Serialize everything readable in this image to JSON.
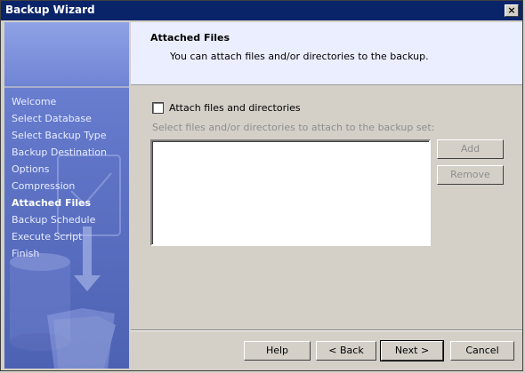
{
  "window": {
    "title": "Backup Wizard",
    "close_label": "×"
  },
  "sidebar": {
    "steps": [
      {
        "label": "Welcome",
        "active": false
      },
      {
        "label": "Select Database",
        "active": false
      },
      {
        "label": "Select Backup Type",
        "active": false
      },
      {
        "label": "Backup Destination",
        "active": false
      },
      {
        "label": "Options",
        "active": false
      },
      {
        "label": "Compression",
        "active": false
      },
      {
        "label": "Attached Files",
        "active": true
      },
      {
        "label": "Backup Schedule",
        "active": false
      },
      {
        "label": "Execute Script",
        "active": false
      },
      {
        "label": "Finish",
        "active": false
      }
    ]
  },
  "header": {
    "title": "Attached Files",
    "subtitle": "You can attach files and/or directories to the backup."
  },
  "content": {
    "checkbox_label": "Attach files and directories",
    "checkbox_checked": false,
    "hint": "Select files and/or directories to attach to the backup set:",
    "add_label": "Add",
    "remove_label": "Remove"
  },
  "footer": {
    "help_label": "Help",
    "back_label": "< Back",
    "next_label": "Next >",
    "cancel_label": "Cancel"
  }
}
